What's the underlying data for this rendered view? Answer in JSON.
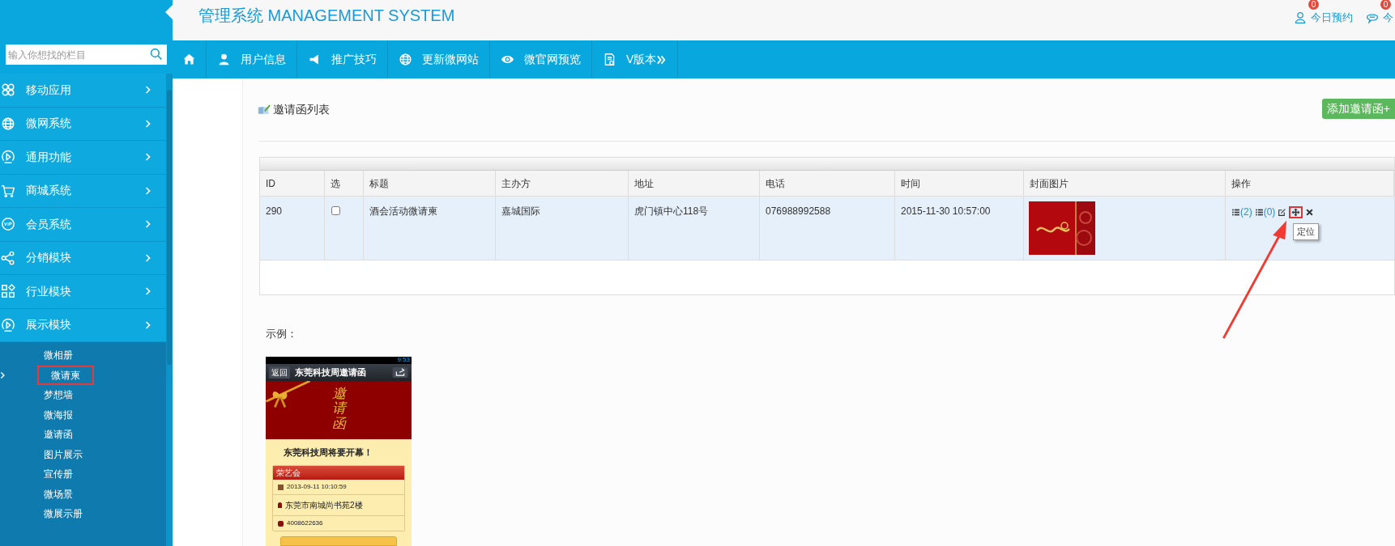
{
  "header": {
    "title": "管理系统 MANAGEMENT SYSTEM",
    "links": [
      {
        "kind": "user",
        "label": "今日预约",
        "badge": "0"
      },
      {
        "kind": "chat",
        "label": "今",
        "badge": "0"
      }
    ]
  },
  "search": {
    "placeholder": "输入你想找的栏目"
  },
  "nav": [
    {
      "kind": "home"
    },
    {
      "kind": "user",
      "label": "用户信息"
    },
    {
      "kind": "megaphone",
      "label": "推广技巧"
    },
    {
      "kind": "globe",
      "label": "更新微网站"
    },
    {
      "kind": "eye",
      "label": "微官网预览"
    },
    {
      "kind": "doc",
      "label": "V版本"
    }
  ],
  "sidebar": {
    "items": [
      {
        "kind": "apps",
        "label": "移动应用"
      },
      {
        "kind": "globe",
        "label": "微网系统"
      },
      {
        "kind": "play",
        "label": "通用功能"
      },
      {
        "kind": "cart",
        "label": "商城系统"
      },
      {
        "kind": "vip",
        "label": "会员系统"
      },
      {
        "kind": "share",
        "label": "分销模块"
      },
      {
        "kind": "grid",
        "label": "行业模块"
      },
      {
        "kind": "play",
        "label": "展示模块",
        "children": [
          {
            "label": "微相册",
            "selected": false
          },
          {
            "label": "微请柬",
            "selected": true
          },
          {
            "label": "梦想墙",
            "selected": false
          },
          {
            "label": "微海报",
            "selected": false
          },
          {
            "label": "邀请函",
            "selected": false
          },
          {
            "label": "图片展示",
            "selected": false
          },
          {
            "label": "宣传册",
            "selected": false
          },
          {
            "label": "微场景",
            "selected": false
          },
          {
            "label": "微展示册",
            "selected": false
          }
        ]
      }
    ]
  },
  "page": {
    "title": "邀请函列表",
    "add_button": "添加邀请函+"
  },
  "table": {
    "columns": [
      "ID",
      "选",
      "标题",
      "主办方",
      "地址",
      "电话",
      "时间",
      "封面图片",
      "操作"
    ],
    "rows": [
      {
        "id": "290",
        "checked": false,
        "title": "酒会活动微请柬",
        "host": "嘉城国际",
        "address": "虎门镇中心118号",
        "phone": "076988992588",
        "time": "2015-11-30 10:57:00",
        "cover": {
          "kind": "picture"
        },
        "actions": [
          {
            "kind": "list",
            "label": "(2)"
          },
          {
            "kind": "list",
            "label": "(0)"
          },
          {
            "kind": "edit"
          },
          {
            "kind": "move",
            "highlighted": true
          },
          {
            "kind": "delete"
          }
        ]
      }
    ]
  },
  "tooltip": "定位",
  "example": {
    "label": "示例：",
    "phone": {
      "time": "9:53",
      "back": "返回",
      "title": "东莞科技周邀请函",
      "banner": "邀请函",
      "headline": "东莞科技周将要开幕！",
      "card_title": "荣艺会",
      "date": "2013-09-11 10:10:59",
      "address": "东莞市南城尚书苑2楼",
      "phone": "4008622636"
    }
  }
}
